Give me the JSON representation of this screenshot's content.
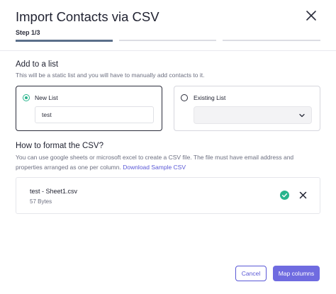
{
  "modal": {
    "title": "Import Contacts via CSV",
    "step_label": "Step 1/3",
    "steps_total": 3,
    "current_step": 1
  },
  "add_to_list": {
    "heading": "Add to a list",
    "description": "This will be a static list and you will have to manually add contacts to it.",
    "new_list": {
      "label": "New List",
      "selected": true,
      "input_value": "test"
    },
    "existing_list": {
      "label": "Existing List",
      "selected": false,
      "select_value": ""
    }
  },
  "format": {
    "heading": "How to format the CSV?",
    "description": "You can use google sheets or microsoft excel to create a CSV file. The file must have email address and properties arranged as one per column. ",
    "link_text": "Download Sample CSV"
  },
  "file": {
    "name": "test - Sheet1.csv",
    "size": "57 Bytes"
  },
  "footer": {
    "cancel_label": "Cancel",
    "primary_label": "Map columns"
  },
  "icons": {
    "close": "close-icon",
    "radio_on": "radio-selected-icon",
    "radio_off": "radio-unselected-icon",
    "chevron": "chevron-down-icon",
    "check": "check-circle-icon",
    "remove": "remove-x-icon"
  },
  "colors": {
    "accent": "#6f6be0",
    "link": "#5a58d6",
    "success": "#28b48c",
    "progress_active": "#5a6f8a",
    "progress_inactive": "#dcdde3"
  }
}
